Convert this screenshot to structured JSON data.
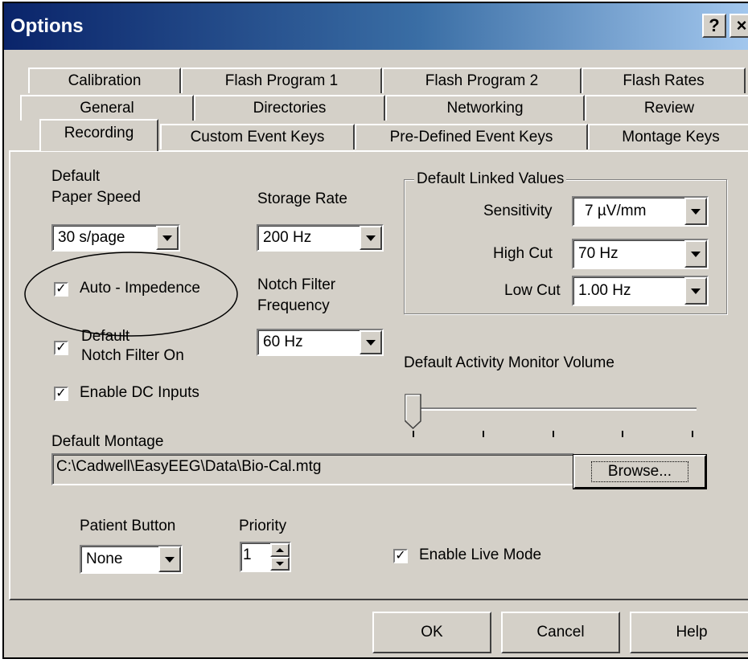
{
  "window": {
    "title": "Options",
    "help_glyph": "?",
    "close_glyph": "×"
  },
  "tabs": {
    "row1": [
      "Calibration",
      "Flash Program 1",
      "Flash Program 2",
      "Flash Rates"
    ],
    "row2": [
      "General",
      "Directories",
      "Networking",
      "Review"
    ],
    "row3": [
      "Recording",
      "Custom Event Keys",
      "Pre-Defined Event Keys",
      "Montage Keys"
    ],
    "active": "Recording"
  },
  "recording": {
    "paper_speed_label_1": "Default",
    "paper_speed_label_2": "Paper Speed",
    "paper_speed_value": "30 s/page",
    "storage_rate_label": "Storage Rate",
    "storage_rate_value": "200 Hz",
    "notch_freq_label_1": "Notch Filter",
    "notch_freq_label_2": "Frequency",
    "notch_freq_value": "60 Hz",
    "auto_impedence_label": "Auto - Impedence",
    "auto_impedence_checked": true,
    "notch_on_label_1": "Default",
    "notch_on_label_2": "Notch Filter On",
    "notch_on_checked": true,
    "enable_dc_label": "Enable DC Inputs",
    "enable_dc_checked": true,
    "linked": {
      "group_title": "Default Linked Values",
      "sensitivity_label": "Sensitivity",
      "sensitivity_value": "7 µV/mm",
      "high_cut_label": "High Cut",
      "high_cut_value": "70 Hz",
      "low_cut_label": "Low Cut",
      "low_cut_value": "1.00 Hz"
    },
    "activity_monitor_label": "Default Activity Monitor Volume",
    "activity_monitor_level": 0,
    "montage_label": "Default Montage",
    "montage_path": "C:\\Cadwell\\EasyEEG\\Data\\Bio-Cal.mtg",
    "browse_label": "Browse...",
    "patient_button_label": "Patient Button",
    "patient_button_value": "None",
    "priority_label": "Priority",
    "priority_value": "1",
    "live_mode_label": "Enable Live Mode",
    "live_mode_checked": true,
    "check_glyph": "✓"
  },
  "footer": {
    "ok_label": "OK",
    "cancel_label": "Cancel",
    "help_label": "Help"
  },
  "colors": {
    "face": "#d4d0c8",
    "title_start": "#0a246a",
    "title_end": "#a6caf0"
  }
}
